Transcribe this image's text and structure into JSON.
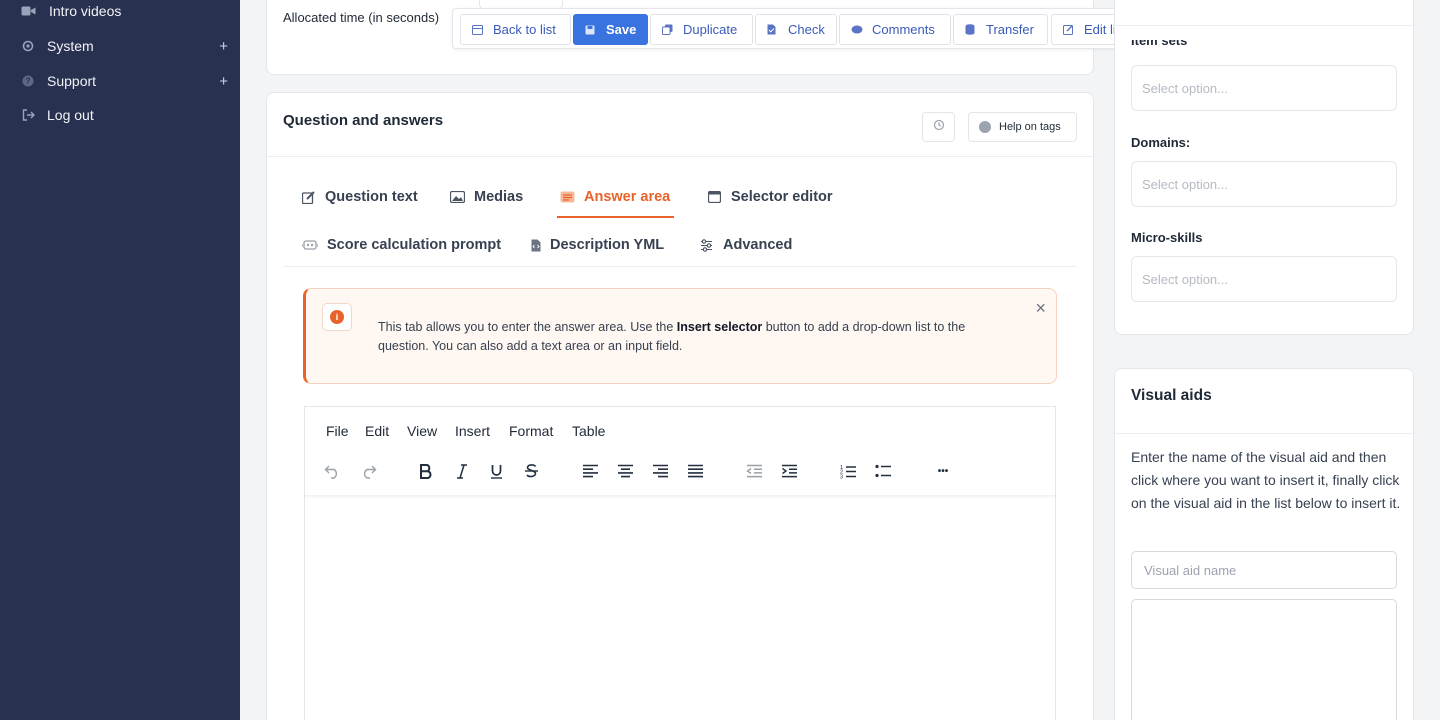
{
  "sidebar": {
    "items": [
      {
        "label": "Intro videos",
        "icon": "video-icon",
        "expandable": false
      },
      {
        "label": "System",
        "icon": "gear-icon",
        "expandable": true
      },
      {
        "label": "Support",
        "icon": "help-circle-icon",
        "expandable": true
      },
      {
        "label": "Log out",
        "icon": "logout-icon",
        "expandable": false
      }
    ],
    "expand_symbol": "+"
  },
  "top_card": {
    "allocated_label": "Allocated time (in seconds)"
  },
  "toolbar": {
    "back": "Back to list",
    "save": "Save",
    "duplicate": "Duplicate",
    "check": "Check",
    "comments": "Comments",
    "transfer": "Transfer",
    "edit_linked": "Edit linked questions"
  },
  "qa": {
    "title": "Question and answers",
    "help": "Help on tags",
    "tabs": [
      {
        "label": "Question text",
        "icon": "edit-icon"
      },
      {
        "label": "Medias",
        "icon": "image-icon"
      },
      {
        "label": "Answer area",
        "icon": "list-icon",
        "active": true
      },
      {
        "label": "Selector editor",
        "icon": "window-icon"
      },
      {
        "label": "Score calculation prompt",
        "icon": "robot-icon"
      },
      {
        "label": "Description YML",
        "icon": "code-file-icon"
      },
      {
        "label": "Advanced",
        "icon": "sliders-icon"
      }
    ]
  },
  "alert": {
    "icon_text": "i",
    "text_before": "This tab allows you to enter the answer area. Use the ",
    "text_bold": "Insert selector",
    "text_after": " button to add a drop-down list to the question. You can also add a text area or an input field.",
    "close": "×"
  },
  "editor": {
    "menu": [
      "File",
      "Edit",
      "View",
      "Insert",
      "Format",
      "Table"
    ],
    "more": "•••"
  },
  "right_panel": {
    "item_sets_label": "Item sets",
    "domains_label": "Domains:",
    "microskills_label": "Micro-skills",
    "select_placeholder": "Select option...",
    "visual_title": "Visual aids",
    "visual_text": "Enter the name of the visual aid and then click where you want to insert it, finally click on the visual aid in the list below to insert it.",
    "visual_placeholder": "Visual aid name"
  },
  "colors": {
    "sidebar_bg": "#283250",
    "accent": "#e8632a",
    "primary": "#3873e0"
  }
}
